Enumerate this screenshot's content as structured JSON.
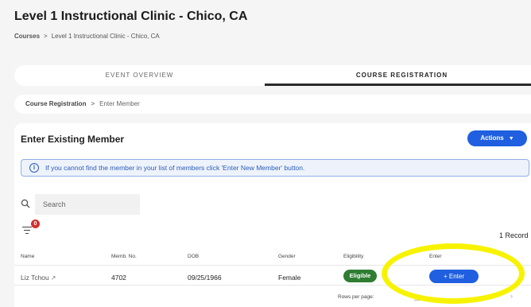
{
  "page": {
    "title": "Level 1 Instructional Clinic - Chico, CA",
    "breadcrumb": {
      "root": "Courses",
      "separator": ">",
      "current": "Level 1 Instructional Clinic - Chico, CA"
    }
  },
  "tabs": [
    {
      "label": "EVENT OVERVIEW",
      "active": false
    },
    {
      "label": "COURSE REGISTRATION",
      "active": true
    }
  ],
  "sub_breadcrumb": {
    "first": "Course Registration",
    "separator": ">",
    "current": "Enter Member"
  },
  "card": {
    "title": "Enter Existing Member",
    "actions_label": "Actions",
    "actions_caret": "▼",
    "info_icon": "info-icon",
    "info_text": "If you cannot find the member in your list of members click 'Enter New Member' button.",
    "search_placeholder": "Search",
    "filter_count": "0",
    "record_count": "1 Record"
  },
  "table": {
    "headers": [
      "Name",
      "Memb. No.",
      "DOB",
      "Gender",
      "Eligibility",
      "Enter"
    ],
    "rows": [
      {
        "name": "Liz Tchou",
        "memb_no": "4702",
        "dob": "09/25/1966",
        "gender": "Female",
        "eligibility": "Eligible",
        "enter_label": "+  Enter"
      }
    ]
  },
  "pagination": {
    "rows_per_page_label": "Rows per page:",
    "next": "›"
  },
  "colors": {
    "accent": "#1f5fe0",
    "eligible": "#2e7d32",
    "badge": "#d32f2f",
    "highlight": "#f7f300"
  }
}
